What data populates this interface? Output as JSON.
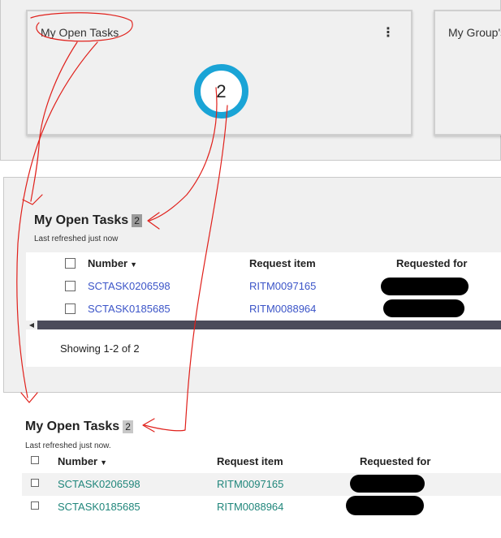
{
  "cards": [
    {
      "title": "My Open Tasks",
      "value": "2"
    },
    {
      "title": "My Group's"
    }
  ],
  "list_top": {
    "title": "My Open Tasks",
    "count": "2",
    "refreshed": "Last refreshed just now",
    "columns": {
      "number": "Number",
      "request_item": "Request item",
      "requested_for": "Requested for"
    },
    "rows": [
      {
        "number": "SCTASK0206598",
        "request_item": "RITM0097165"
      },
      {
        "number": "SCTASK0185685",
        "request_item": "RITM0088964"
      }
    ],
    "showing": "Showing 1-2 of 2"
  },
  "list_bottom": {
    "title": "My Open Tasks",
    "count": "2",
    "refreshed": "Last refreshed just now.",
    "columns": {
      "number": "Number",
      "request_item": "Request item",
      "requested_for": "Requested for"
    },
    "rows": [
      {
        "number": "SCTASK0206598",
        "request_item": "RITM0097165"
      },
      {
        "number": "SCTASK0185685",
        "request_item": "RITM0088964"
      }
    ]
  },
  "icons": {
    "kebab": "more-vertical-icon",
    "sort": "sort-down-icon",
    "scroll_left": "scroll-left-arrow-icon"
  },
  "colors": {
    "donut": "#1aa4d6",
    "link_blue": "#3c55c8",
    "link_teal": "#20867b",
    "annotation": "#e0201b"
  }
}
